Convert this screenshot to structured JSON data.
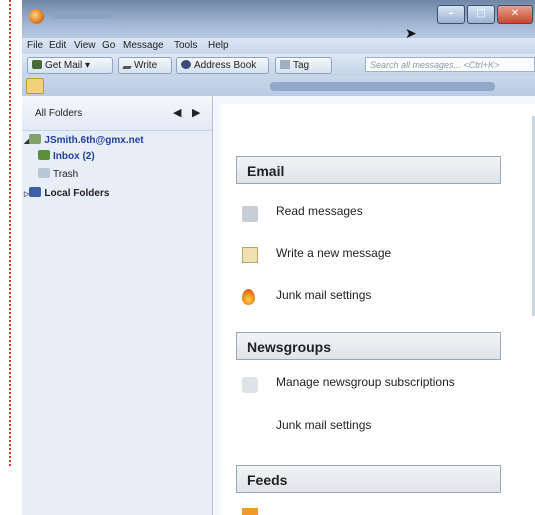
{
  "menu": [
    "File",
    "Edit",
    "View",
    "Go",
    "Message",
    "Tools",
    "Help"
  ],
  "toolbar": {
    "get_mail": "Get Mail",
    "write": "Write",
    "address_book": "Address Book",
    "tag": "Tag",
    "search_placeholder": "Search all messages... <Ctrl+K>"
  },
  "folders": {
    "header": "All Folders",
    "account": "JSmith.6th@gmx.net",
    "inbox": "Inbox (2)",
    "trash": "Trash",
    "local": "Local Folders"
  },
  "sections": {
    "email": {
      "title": "Email",
      "items": [
        "Read messages",
        "Write a new message",
        "Junk mail settings"
      ]
    },
    "newsgroups": {
      "title": "Newsgroups",
      "items": [
        "Manage newsgroup subscriptions",
        "Junk mail settings"
      ]
    },
    "feeds": {
      "title": "Feeds"
    }
  },
  "colors": {
    "account_text": "#1e3fa0",
    "frame_dots": "#d33a2c"
  }
}
